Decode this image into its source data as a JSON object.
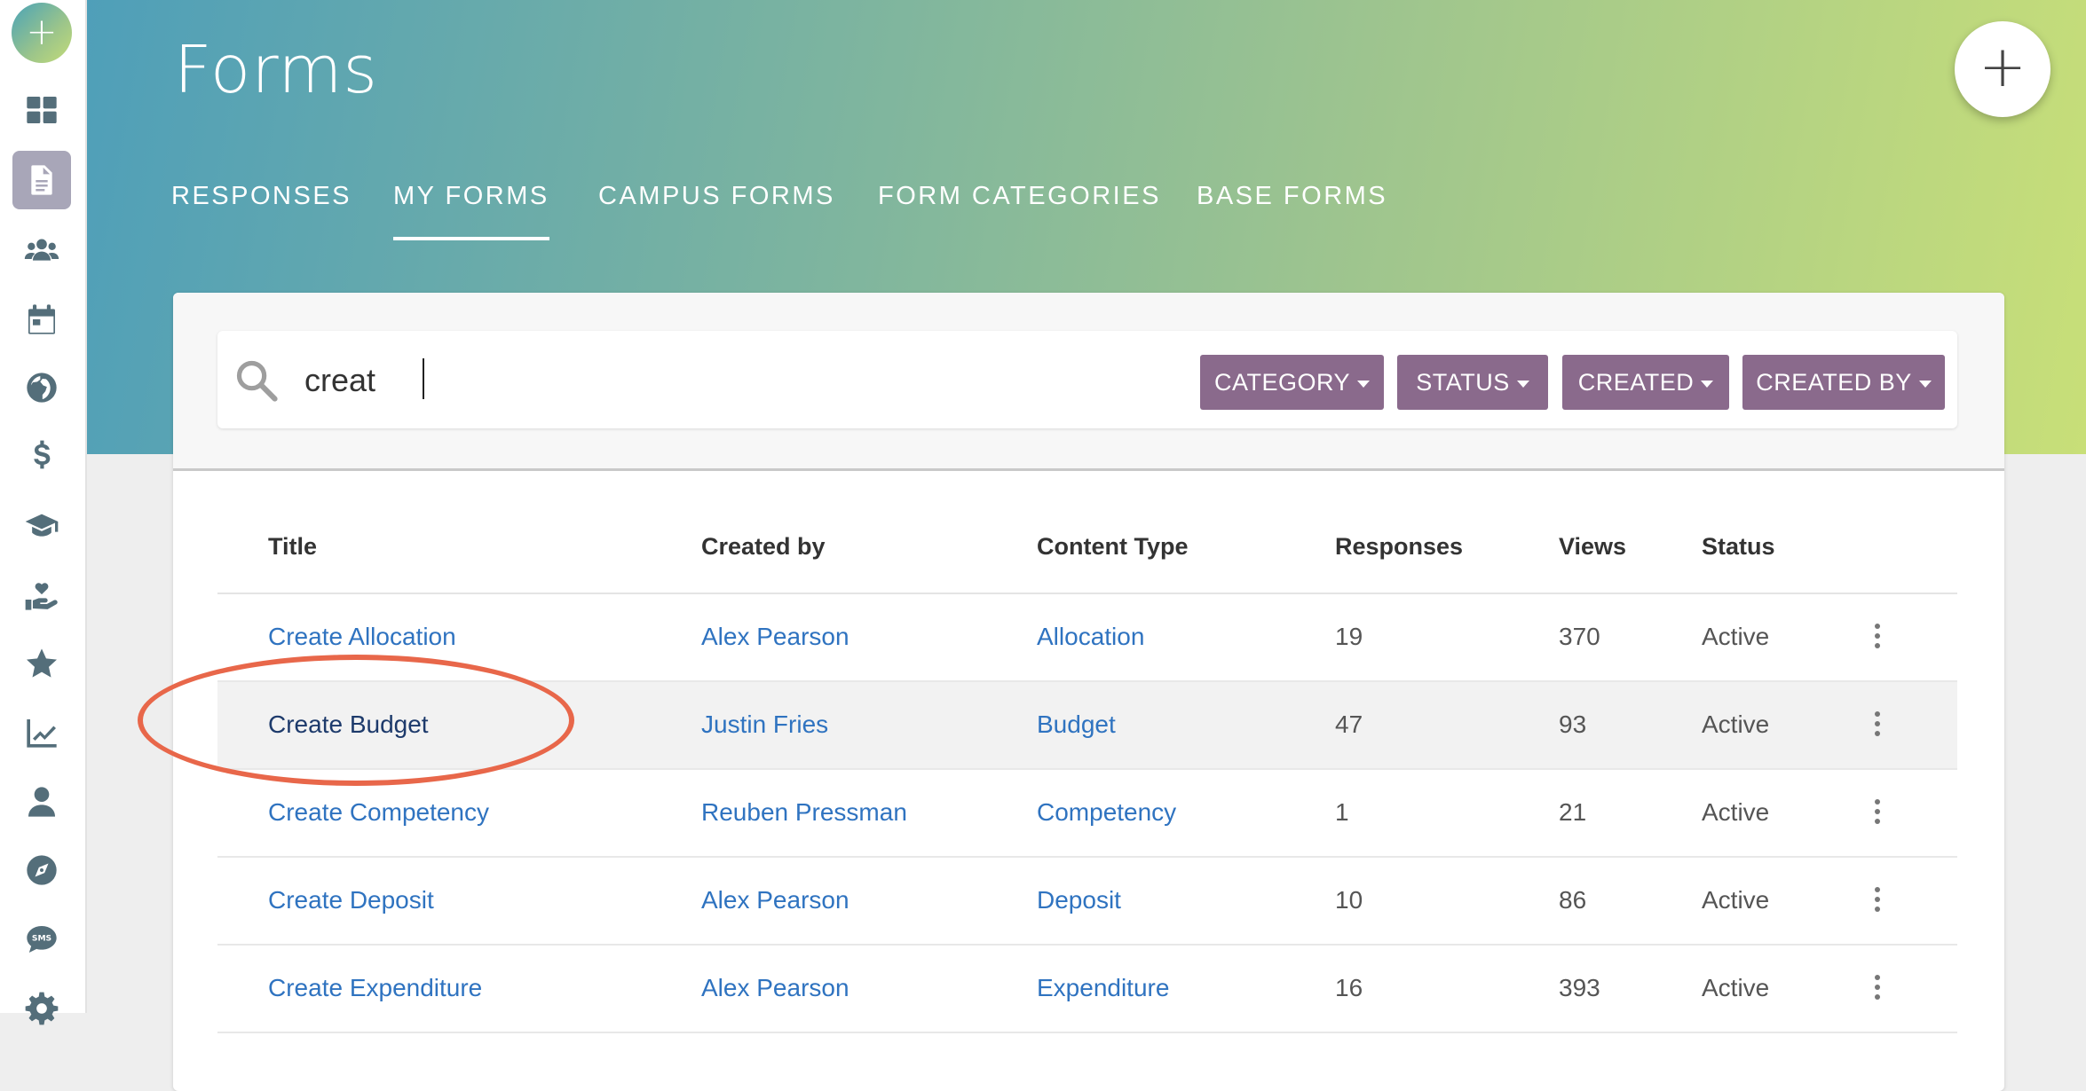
{
  "app": {
    "title": "Forms",
    "add_icon": "plus-icon"
  },
  "sidebar": {
    "items": [
      {
        "icon": "dashboard-icon",
        "active": false
      },
      {
        "icon": "document-icon",
        "active": true
      },
      {
        "icon": "users-icon",
        "active": false
      },
      {
        "icon": "calendar-icon",
        "active": false
      },
      {
        "icon": "globe-icon",
        "active": false
      },
      {
        "icon": "dollar-icon",
        "active": false
      },
      {
        "icon": "graduation-cap-icon",
        "active": false
      },
      {
        "icon": "hand-heart-icon",
        "active": false
      },
      {
        "icon": "star-icon",
        "active": false
      },
      {
        "icon": "chart-line-icon",
        "active": false
      },
      {
        "icon": "user-icon",
        "active": false
      },
      {
        "icon": "compass-icon",
        "active": false
      },
      {
        "icon": "sms-icon",
        "active": false
      },
      {
        "icon": "gear-icon",
        "active": false
      }
    ]
  },
  "tabs": [
    {
      "label": "RESPONSES"
    },
    {
      "label": "MY FORMS"
    },
    {
      "label": "CAMPUS FORMS"
    },
    {
      "label": "FORM CATEGORIES"
    },
    {
      "label": "BASE FORMS"
    }
  ],
  "search": {
    "value": "creat",
    "icon": "search-icon"
  },
  "filters": [
    {
      "label": "CATEGORY"
    },
    {
      "label": "STATUS"
    },
    {
      "label": "CREATED"
    },
    {
      "label": "CREATED BY"
    }
  ],
  "table": {
    "columns": [
      "Title",
      "Created by",
      "Content Type",
      "Responses",
      "Views",
      "Status"
    ],
    "rows": [
      {
        "title": "Create Allocation",
        "created_by": "Alex Pearson",
        "content_type": "Allocation",
        "responses": "19",
        "views": "370",
        "status": "Active"
      },
      {
        "title": "Create Budget",
        "created_by": "Justin Fries",
        "content_type": "Budget",
        "responses": "47",
        "views": "93",
        "status": "Active"
      },
      {
        "title": "Create Competency",
        "created_by": "Reuben Pressman",
        "content_type": "Competency",
        "responses": "1",
        "views": "21",
        "status": "Active"
      },
      {
        "title": "Create Deposit",
        "created_by": "Alex Pearson",
        "content_type": "Deposit",
        "responses": "10",
        "views": "86",
        "status": "Active"
      },
      {
        "title": "Create Expenditure",
        "created_by": "Alex Pearson",
        "content_type": "Expenditure",
        "responses": "16",
        "views": "393",
        "status": "Active"
      }
    ]
  },
  "colors": {
    "accent": "#8a6a8c",
    "link": "#2f73c0",
    "annotation": "#e8674a"
  }
}
